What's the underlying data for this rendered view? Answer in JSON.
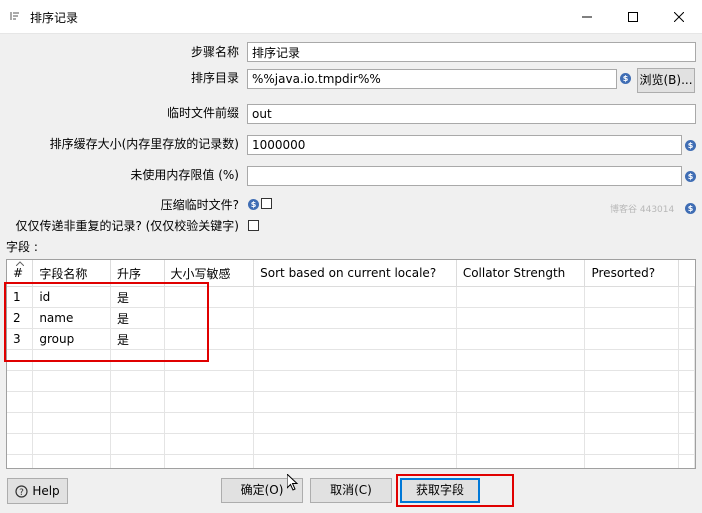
{
  "window": {
    "title": "排序记录"
  },
  "form": {
    "step_name_label": "步骤名称",
    "step_name_value": "排序记录",
    "sort_dir_label": "排序目录",
    "sort_dir_value": "%%java.io.tmpdir%%",
    "browse_label": "浏览(B)...",
    "temp_prefix_label": "临时文件前缀",
    "temp_prefix_value": "out",
    "sort_size_label": "排序缓存大小(内存里存放的记录数)",
    "sort_size_value": "1000000",
    "free_mem_label": "未使用内存限值 (%)",
    "free_mem_value": "",
    "compress_label": "压缩临时文件?",
    "unique_label": "仅仅传递非重复的记录? (仅仅校验关键字)",
    "fields_label": "字段 :"
  },
  "table": {
    "columns": [
      "#",
      "字段名称",
      "升序",
      "大小写敏感",
      "Sort based on current locale?",
      "Collator Strength",
      "Presorted?"
    ],
    "rows": [
      {
        "num": "1",
        "name": "id",
        "asc": "是"
      },
      {
        "num": "2",
        "name": "name",
        "asc": "是"
      },
      {
        "num": "3",
        "name": "group",
        "asc": "是"
      }
    ]
  },
  "buttons": {
    "help": "Help",
    "ok": "确定(O)",
    "cancel": "取消(C)",
    "get_fields": "获取字段"
  },
  "watermark": "博客谷 443014",
  "colors": {
    "highlight": "#e00000",
    "variable_icon": "#3f6db4",
    "focus": "#0078d7"
  }
}
